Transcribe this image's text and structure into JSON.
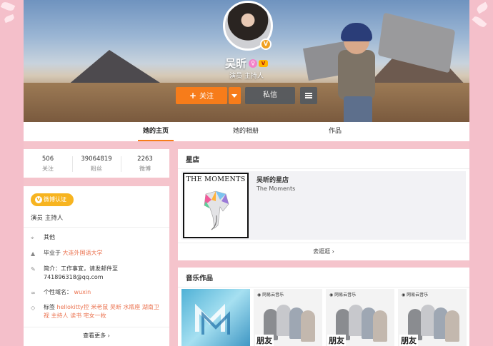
{
  "profile": {
    "name": "吴昕",
    "description": "演员 主持人",
    "follow_label": "关注",
    "message_label": "私信",
    "verified_symbol": "V"
  },
  "tabs": [
    {
      "label": "她的主页",
      "active": true
    },
    {
      "label": "她的相册",
      "active": false
    },
    {
      "label": "作品",
      "active": false
    }
  ],
  "stats": [
    {
      "value": "506",
      "label": "关注"
    },
    {
      "value": "39064819",
      "label": "粉丝"
    },
    {
      "value": "2263",
      "label": "微博"
    }
  ],
  "info": {
    "auth_badge": "微博认证",
    "auth_desc": "演员 主持人",
    "location": "其他",
    "education_prefix": "毕业于",
    "education_school": "大连外国语大学",
    "intro_label": "简介：",
    "intro_text": "工作事宜，请发邮件至741896318@qq.com",
    "domain_label": "个性域名：",
    "domain_value": "wuxin",
    "tags_label": "标签",
    "tags_text": "hellokitty控 米老鼠 吴昕 水瓶座 湖南卫视 主持人 读书 宅女一枚",
    "see_more": "查看更多"
  },
  "store": {
    "title": "星店",
    "item_name": "吴昕的星店",
    "item_sub": "The Moments",
    "album_title": "THE MOMENTS",
    "link": "去逛逛"
  },
  "music": {
    "title": "音乐作品",
    "brand": "网易云音乐",
    "poster_title": "朋友"
  },
  "colors": {
    "accent": "#f77c1a",
    "page_bg": "#f5c4cc",
    "link": "#eb7350",
    "auth": "#f7b420"
  }
}
